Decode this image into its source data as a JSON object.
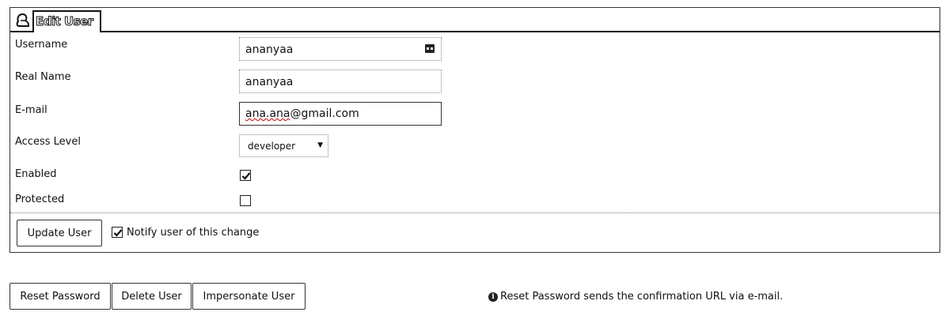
{
  "panel": {
    "title": "Edit User",
    "title_icon": "user-icon"
  },
  "form": {
    "username": {
      "label": "Username",
      "value": "ananyaa",
      "icon": "keyboard-icon"
    },
    "real_name": {
      "label": "Real Name",
      "value": "ananyaa"
    },
    "email": {
      "label": "E-mail",
      "value_user": "ana.ana",
      "value_domain": "@gmail.com"
    },
    "access_level": {
      "label": "Access Level",
      "value": "developer"
    },
    "enabled": {
      "label": "Enabled",
      "checked": true
    },
    "protected": {
      "label": "Protected",
      "checked": false
    }
  },
  "actions": {
    "update_label": "Update User",
    "notify_label": "Notify user of this change",
    "notify_checked": true
  },
  "bottom_buttons": {
    "reset_password": "Reset Password",
    "delete_user": "Delete User",
    "impersonate_user": "Impersonate User"
  },
  "info": {
    "icon": "info-icon",
    "text": "Reset Password sends the confirmation URL via e-mail."
  }
}
